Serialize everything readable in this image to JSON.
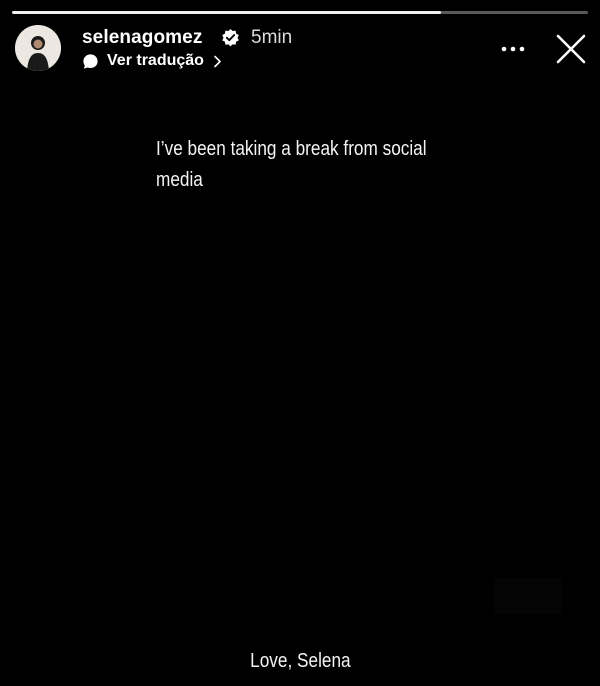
{
  "progress": {
    "fraction": 0.745
  },
  "header": {
    "username": "selenagomez",
    "verified": true,
    "time": "5min",
    "translate_label": "Ver tradução"
  },
  "icons": {
    "avatar": "avatar-photo",
    "verified": "verified-badge-icon",
    "translate": "translate-bubble-icon",
    "chevron": "chevron-right-icon",
    "more": "more-horizontal-icon",
    "close": "close-icon"
  },
  "story": {
    "message": "I’ve been taking a break from social\nmedia",
    "signature": "Love, Selena"
  },
  "colors": {
    "background": "#000000",
    "text": "#f4f4f4",
    "progress_track": "#5a5a5a",
    "progress_fill": "#f2f2f2"
  }
}
